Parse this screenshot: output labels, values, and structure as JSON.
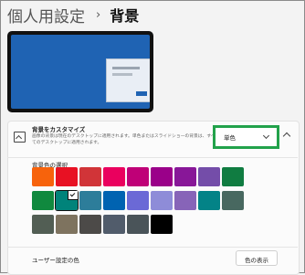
{
  "header": {
    "parent": "個人用設定",
    "separator": "›",
    "current": "背景"
  },
  "personalize": {
    "title": "背景をカスタマイズ",
    "description": "画像の背景は現在のデスクトップに適用されます。単色またはスライドショーの背景は、すべてのデスクトップに適用されます。",
    "dropdown_value": "単色"
  },
  "colors": {
    "label": "背景色の選択",
    "selected_index": 10,
    "swatches": [
      "#f7630c",
      "#e81123",
      "#d13438",
      "#ea005e",
      "#bf0077",
      "#9a0089",
      "#881798",
      "#744da9",
      "#107c41",
      "#10893e",
      "#00837a",
      "#2d7d9a",
      "#0063b1",
      "#6b69d6",
      "#8e8cd8",
      "#8764b8",
      "#038387",
      "#486860",
      "#525e54",
      "#7e735f",
      "#4c4a48",
      "#515c6b",
      "#4a5459",
      "#000000"
    ]
  },
  "custom": {
    "label": "ユーザー設定の色",
    "button": "色の表示"
  }
}
